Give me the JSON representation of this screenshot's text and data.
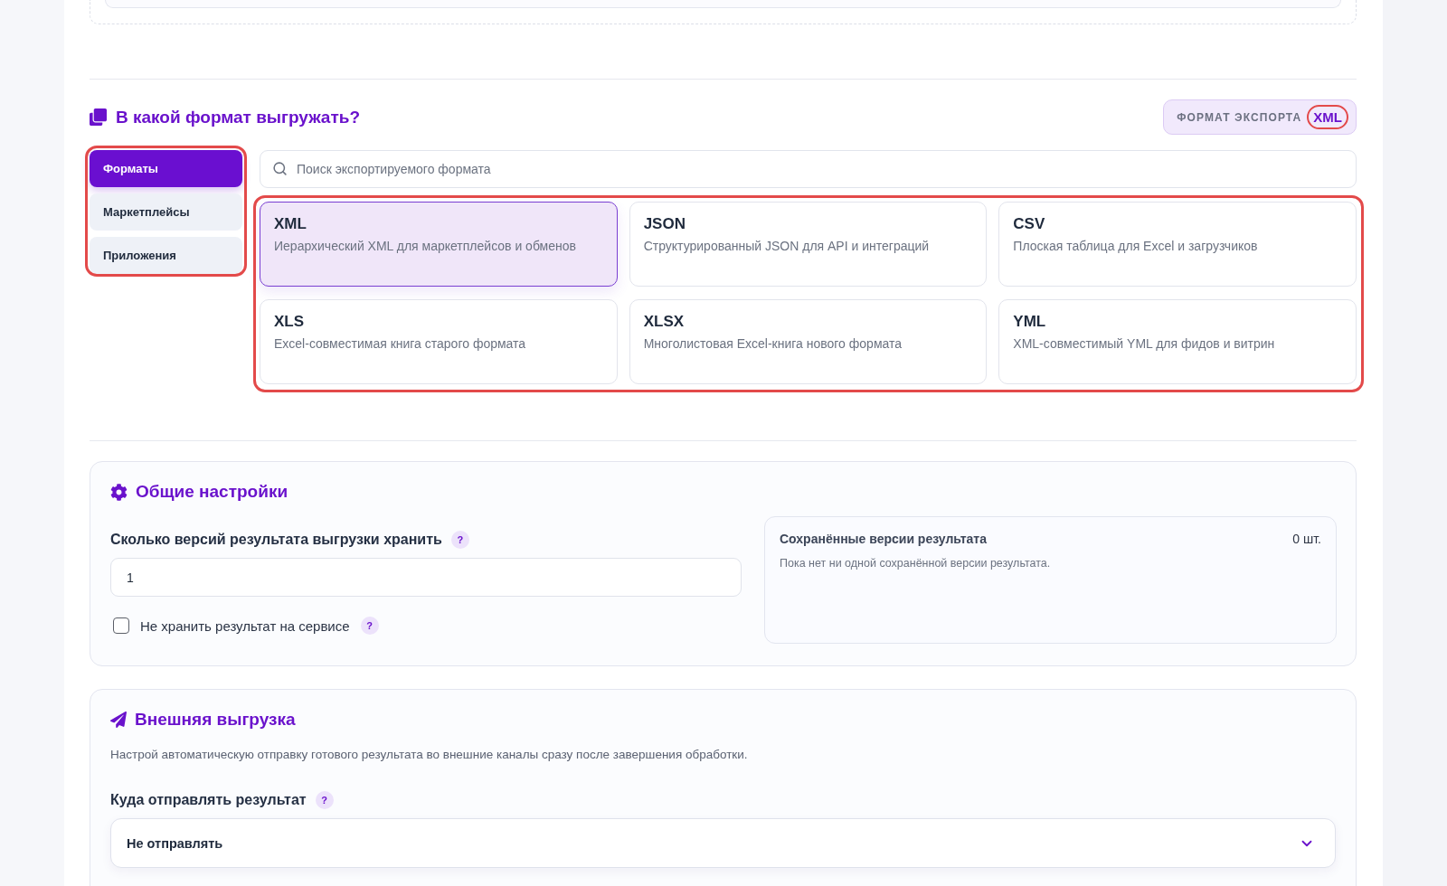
{
  "format_section": {
    "title": "В какой формат выгружать?",
    "badge": {
      "label": "ФОРМАТ ЭКСПОРТА",
      "value": "XML",
      "highlighted": true
    },
    "tabs_highlighted": true,
    "tabs": [
      {
        "label": "Форматы",
        "selected": true
      },
      {
        "label": "Маркетплейсы",
        "selected": false
      },
      {
        "label": "Приложения",
        "selected": false
      }
    ],
    "search": {
      "placeholder": "Поиск экспортируемого формата"
    },
    "formats_highlighted": true,
    "formats": [
      {
        "name": "XML",
        "description": "Иерархический XML для маркетплейсов и обменов",
        "selected": true
      },
      {
        "name": "JSON",
        "description": "Структурированный JSON для API и интеграций",
        "selected": false
      },
      {
        "name": "CSV",
        "description": "Плоская таблица для Excel и загрузчиков",
        "selected": false
      },
      {
        "name": "XLS",
        "description": "Excel-совместимая книга старого формата",
        "selected": false
      },
      {
        "name": "XLSX",
        "description": "Многолистовая Excel-книга нового формата",
        "selected": false
      },
      {
        "name": "YML",
        "description": "XML-совместимый YML для фидов и витрин",
        "selected": false
      }
    ]
  },
  "general_settings": {
    "title": "Общие настройки",
    "versions_field": {
      "label": "Сколько версий результата выгрузки хранить",
      "help": "?",
      "value": "1"
    },
    "no_store": {
      "label": "Не хранить результат на сервисе",
      "help": "?",
      "checked": false
    },
    "saved_versions": {
      "title": "Сохранённые версии результата",
      "count": "0 шт.",
      "empty_text": "Пока нет ни одной сохранённой версии результата."
    }
  },
  "external_upload": {
    "title": "Внешняя выгрузка",
    "description": "Настрой автоматическую отправку готового результата во внешние каналы сразу после завершения обработки.",
    "destination": {
      "label": "Куда отправлять результат",
      "help": "?",
      "value": "Не отправлять"
    }
  }
}
